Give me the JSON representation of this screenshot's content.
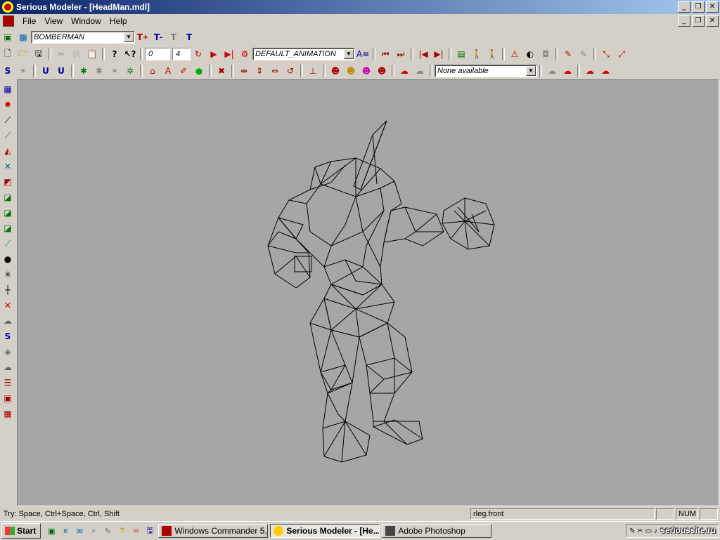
{
  "window": {
    "title": "Serious Modeler - [HeadMan.mdl]",
    "minimize": "_",
    "restore": "❐",
    "close": "✕"
  },
  "menu": {
    "items": [
      "File",
      "View",
      "Window",
      "Help"
    ]
  },
  "toolbar1": {
    "project_combo": "BOMBERMAN"
  },
  "toolbar2": {
    "frame_start": "0",
    "frame_end": "4",
    "animation_combo": "DEFAULT_ANIMATION"
  },
  "toolbar3": {
    "collision_combo": "None available"
  },
  "viewport": {
    "model": "wireframe-humanoid"
  },
  "status": {
    "hint": "Try: Space, Ctrl+Space, Ctrl, Shift",
    "surface": "rleg.front",
    "num": "NUM"
  },
  "taskbar": {
    "start": "Start",
    "tasks": [
      {
        "label": "Windows Commander 5....",
        "active": false
      },
      {
        "label": "Serious Modeler - [He...",
        "active": true
      },
      {
        "label": "Adobe Photoshop",
        "active": false
      }
    ],
    "watermark": "serioussite.ru"
  }
}
